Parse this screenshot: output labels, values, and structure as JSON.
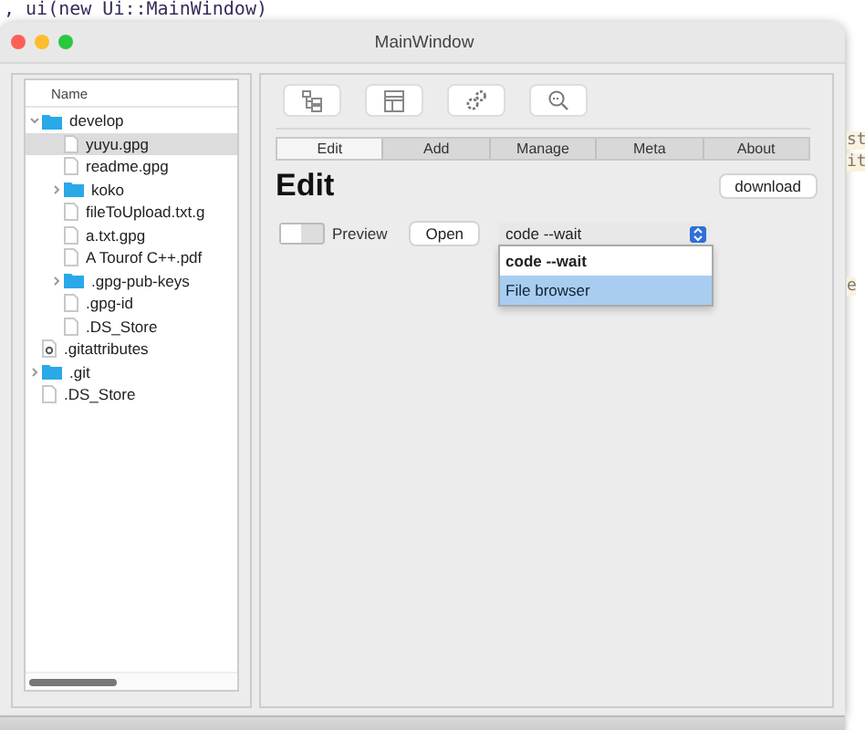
{
  "editor_background": {
    "code_line": ", ui(new Ui::MainWindow)",
    "fragments": [
      "st",
      "it",
      "e"
    ]
  },
  "window": {
    "title": "MainWindow"
  },
  "file_tree": {
    "header": "Name",
    "items": [
      {
        "name": "develop",
        "kind": "folder",
        "expanded": true,
        "selected": false,
        "children": [
          {
            "name": "yuyu.gpg",
            "kind": "file",
            "selected": true
          },
          {
            "name": "readme.gpg",
            "kind": "file",
            "selected": false
          },
          {
            "name": "koko",
            "kind": "folder",
            "expanded": false,
            "selected": false
          },
          {
            "name": "fileToUpload.txt.g",
            "kind": "file",
            "selected": false
          },
          {
            "name": "a.txt.gpg",
            "kind": "file",
            "selected": false
          },
          {
            "name": "A Tourof C++.pdf",
            "kind": "file",
            "selected": false
          },
          {
            "name": ".gpg-pub-keys",
            "kind": "folder",
            "expanded": false,
            "selected": false
          },
          {
            "name": ".gpg-id",
            "kind": "file",
            "selected": false
          },
          {
            "name": ".DS_Store",
            "kind": "file",
            "selected": false
          }
        ]
      },
      {
        "name": ".gitattributes",
        "kind": "config",
        "selected": false
      },
      {
        "name": ".git",
        "kind": "folder",
        "expanded": false,
        "selected": false
      },
      {
        "name": ".DS_Store",
        "kind": "file",
        "selected": false
      }
    ]
  },
  "toolbar": [
    {
      "kind": "tree"
    },
    {
      "kind": "layout"
    },
    {
      "kind": "gears"
    },
    {
      "kind": "search"
    }
  ],
  "tabs": [
    {
      "label": "Edit",
      "selected": true
    },
    {
      "label": "Add",
      "selected": false
    },
    {
      "label": "Manage",
      "selected": false
    },
    {
      "label": "Meta",
      "selected": false
    },
    {
      "label": "About",
      "selected": false
    }
  ],
  "edit": {
    "heading": "Edit",
    "download_button": "download",
    "preview_toggle": {
      "on": false
    },
    "preview_label": "Preview",
    "open_button": "Open",
    "program_select": {
      "value": "code --wait",
      "options": [
        {
          "label": "code --wait",
          "selected": true,
          "highlighted": false
        },
        {
          "label": "File browser",
          "selected": false,
          "highlighted": true
        }
      ]
    }
  }
}
